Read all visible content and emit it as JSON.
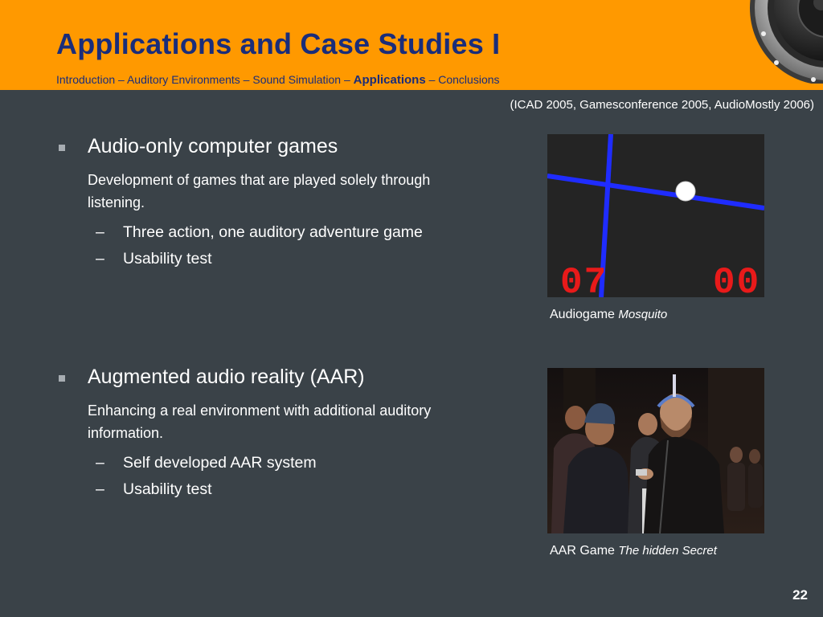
{
  "slide": {
    "title": "Applications and Case Studies I",
    "breadcrumb": {
      "before": "Introduction – Auditory Environments – Sound Simulation – ",
      "active": "Applications",
      "after": " – Conclusions"
    },
    "citation": "(ICAD 2005, Gamesconference 2005, AudioMostly 2006)",
    "page_number": "22"
  },
  "sections": [
    {
      "heading": "Audio-only computer games",
      "description": "Development of games that are played solely through listening.",
      "subitems": [
        "Three action, one auditory adventure game",
        "Usability test"
      ]
    },
    {
      "heading": "Augmented audio reality (AAR)",
      "description": "Enhancing a real environment with additional auditory information.",
      "subitems": [
        "Self developed AAR system",
        "Usability test"
      ]
    }
  ],
  "figures": [
    {
      "caption_prefix": "Audiogame ",
      "caption_title": "Mosquito",
      "score_left": "07",
      "score_right": "00"
    },
    {
      "caption_prefix": "AAR Game ",
      "caption_title": "The hidden Secret"
    }
  ],
  "colors": {
    "header_bg": "#ff9900",
    "title_text": "#1a2d7a",
    "slide_bg": "#3a4248",
    "game_line": "#1f2cff",
    "digits": "#e81a1a"
  }
}
